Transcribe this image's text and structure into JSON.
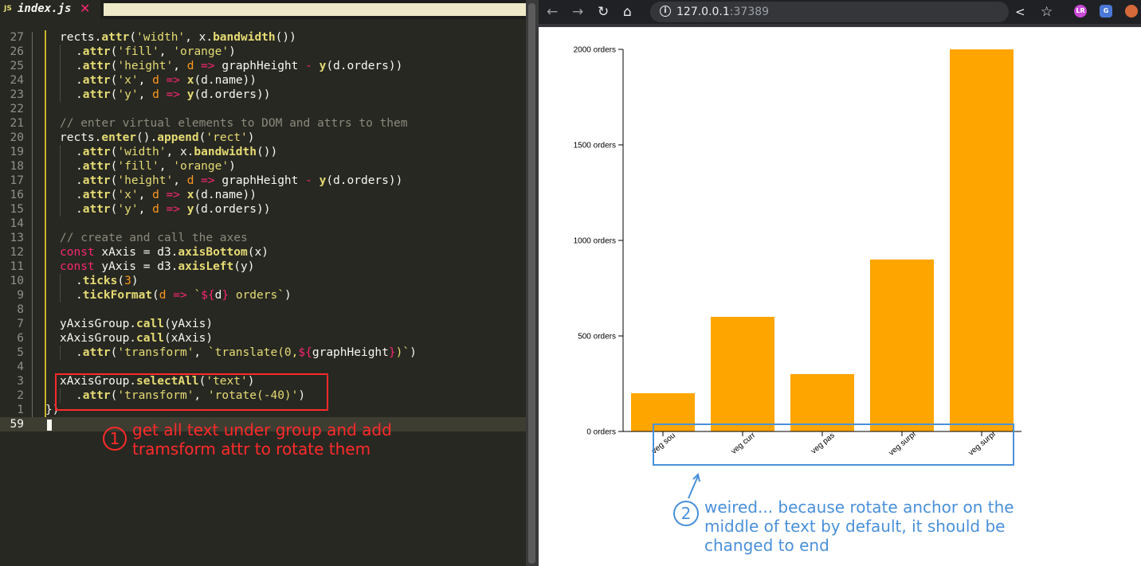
{
  "editor": {
    "tab": {
      "badge": "JS",
      "filename": "index.js",
      "close_glyph": "✕"
    },
    "lines": [
      {
        "num": "27",
        "segs": [
          [
            "v",
            "rects."
          ],
          [
            "f",
            "attr"
          ],
          [
            "v",
            "("
          ],
          [
            "s",
            "'width'"
          ],
          [
            "v",
            ", x."
          ],
          [
            "f",
            "bandwidth"
          ],
          [
            "v",
            "())"
          ]
        ],
        "indent": 0
      },
      {
        "num": "26",
        "segs": [
          [
            "v",
            "."
          ],
          [
            "f",
            "attr"
          ],
          [
            "v",
            "("
          ],
          [
            "s",
            "'fill'"
          ],
          [
            "v",
            ", "
          ],
          [
            "s",
            "'orange'"
          ],
          [
            "v",
            ")"
          ]
        ],
        "indent": 1
      },
      {
        "num": "25",
        "segs": [
          [
            "v",
            "."
          ],
          [
            "f",
            "attr"
          ],
          [
            "v",
            "("
          ],
          [
            "s",
            "'height'"
          ],
          [
            "v",
            ", "
          ],
          [
            "a",
            "d"
          ],
          [
            "o",
            " => "
          ],
          [
            "v",
            "graphHeight "
          ],
          [
            "o",
            "-"
          ],
          [
            "v",
            " "
          ],
          [
            "f",
            "y"
          ],
          [
            "v",
            "(d.orders))"
          ]
        ],
        "indent": 1
      },
      {
        "num": "24",
        "segs": [
          [
            "v",
            "."
          ],
          [
            "f",
            "attr"
          ],
          [
            "v",
            "("
          ],
          [
            "s",
            "'x'"
          ],
          [
            "v",
            ", "
          ],
          [
            "a",
            "d"
          ],
          [
            "o",
            " => "
          ],
          [
            "f",
            "x"
          ],
          [
            "v",
            "(d.name))"
          ]
        ],
        "indent": 1
      },
      {
        "num": "23",
        "segs": [
          [
            "v",
            "."
          ],
          [
            "f",
            "attr"
          ],
          [
            "v",
            "("
          ],
          [
            "s",
            "'y'"
          ],
          [
            "v",
            ", "
          ],
          [
            "a",
            "d"
          ],
          [
            "o",
            " => "
          ],
          [
            "f",
            "y"
          ],
          [
            "v",
            "(d.orders))"
          ]
        ],
        "indent": 1
      },
      {
        "num": "22",
        "segs": [],
        "indent": 0
      },
      {
        "num": "21",
        "segs": [
          [
            "c",
            "// enter virtual elements to DOM and attrs to them"
          ]
        ],
        "indent": 0
      },
      {
        "num": "20",
        "segs": [
          [
            "v",
            "rects."
          ],
          [
            "f",
            "enter"
          ],
          [
            "v",
            "()."
          ],
          [
            "f",
            "append"
          ],
          [
            "v",
            "("
          ],
          [
            "s",
            "'rect'"
          ],
          [
            "v",
            ")"
          ]
        ],
        "indent": 0
      },
      {
        "num": "19",
        "segs": [
          [
            "v",
            "."
          ],
          [
            "f",
            "attr"
          ],
          [
            "v",
            "("
          ],
          [
            "s",
            "'width'"
          ],
          [
            "v",
            ", x."
          ],
          [
            "f",
            "bandwidth"
          ],
          [
            "v",
            "())"
          ]
        ],
        "indent": 1
      },
      {
        "num": "18",
        "segs": [
          [
            "v",
            "."
          ],
          [
            "f",
            "attr"
          ],
          [
            "v",
            "("
          ],
          [
            "s",
            "'fill'"
          ],
          [
            "v",
            ", "
          ],
          [
            "s",
            "'orange'"
          ],
          [
            "v",
            ")"
          ]
        ],
        "indent": 1
      },
      {
        "num": "17",
        "segs": [
          [
            "v",
            "."
          ],
          [
            "f",
            "attr"
          ],
          [
            "v",
            "("
          ],
          [
            "s",
            "'height'"
          ],
          [
            "v",
            ", "
          ],
          [
            "a",
            "d"
          ],
          [
            "o",
            " => "
          ],
          [
            "v",
            "graphHeight "
          ],
          [
            "o",
            "-"
          ],
          [
            "v",
            " "
          ],
          [
            "f",
            "y"
          ],
          [
            "v",
            "(d.orders))"
          ]
        ],
        "indent": 1
      },
      {
        "num": "16",
        "segs": [
          [
            "v",
            "."
          ],
          [
            "f",
            "attr"
          ],
          [
            "v",
            "("
          ],
          [
            "s",
            "'x'"
          ],
          [
            "v",
            ", "
          ],
          [
            "a",
            "d"
          ],
          [
            "o",
            " => "
          ],
          [
            "f",
            "x"
          ],
          [
            "v",
            "(d.name))"
          ]
        ],
        "indent": 1
      },
      {
        "num": "15",
        "segs": [
          [
            "v",
            "."
          ],
          [
            "f",
            "attr"
          ],
          [
            "v",
            "("
          ],
          [
            "s",
            "'y'"
          ],
          [
            "v",
            ", "
          ],
          [
            "a",
            "d"
          ],
          [
            "o",
            " => "
          ],
          [
            "f",
            "y"
          ],
          [
            "v",
            "(d.orders))"
          ]
        ],
        "indent": 1
      },
      {
        "num": "14",
        "segs": [],
        "indent": 0
      },
      {
        "num": "13",
        "segs": [
          [
            "c",
            "// create and call the axes"
          ]
        ],
        "indent": 0
      },
      {
        "num": "12",
        "segs": [
          [
            "k",
            "const"
          ],
          [
            "v",
            " xAxis = d3."
          ],
          [
            "f",
            "axisBottom"
          ],
          [
            "v",
            "(x)"
          ]
        ],
        "indent": 0
      },
      {
        "num": "11",
        "segs": [
          [
            "k",
            "const"
          ],
          [
            "v",
            " yAxis = d3."
          ],
          [
            "f",
            "axisLeft"
          ],
          [
            "v",
            "(y)"
          ]
        ],
        "indent": 0
      },
      {
        "num": "10",
        "segs": [
          [
            "v",
            "."
          ],
          [
            "f",
            "ticks"
          ],
          [
            "v",
            "("
          ],
          [
            "a",
            "3"
          ],
          [
            "v",
            ")"
          ]
        ],
        "indent": 1
      },
      {
        "num": "9",
        "segs": [
          [
            "v",
            "."
          ],
          [
            "f",
            "tickFormat"
          ],
          [
            "v",
            "("
          ],
          [
            "a",
            "d"
          ],
          [
            "o",
            " => "
          ],
          [
            "s",
            "`"
          ],
          [
            "k",
            "${"
          ],
          [
            "v",
            "d"
          ],
          [
            "k",
            "}"
          ],
          [
            "s",
            " orders`"
          ],
          [
            "v",
            ")"
          ]
        ],
        "indent": 1
      },
      {
        "num": "8",
        "segs": [],
        "indent": 0
      },
      {
        "num": "7",
        "segs": [
          [
            "v",
            "yAxisGroup."
          ],
          [
            "f",
            "call"
          ],
          [
            "v",
            "(yAxis)"
          ]
        ],
        "indent": 0
      },
      {
        "num": "6",
        "segs": [
          [
            "v",
            "xAxisGroup."
          ],
          [
            "f",
            "call"
          ],
          [
            "v",
            "(xAxis)"
          ]
        ],
        "indent": 0
      },
      {
        "num": "5",
        "segs": [
          [
            "v",
            "."
          ],
          [
            "f",
            "attr"
          ],
          [
            "v",
            "("
          ],
          [
            "s",
            "'transform'"
          ],
          [
            "v",
            ", "
          ],
          [
            "s",
            "`translate(0,"
          ],
          [
            "k",
            "${"
          ],
          [
            "v",
            "graphHeight"
          ],
          [
            "k",
            "}"
          ],
          [
            "s",
            ")`"
          ],
          [
            "v",
            ")"
          ]
        ],
        "indent": 1
      },
      {
        "num": "4",
        "segs": [],
        "indent": 0
      },
      {
        "num": "3",
        "segs": [
          [
            "v",
            "xAxisGroup."
          ],
          [
            "f",
            "selectAll"
          ],
          [
            "v",
            "("
          ],
          [
            "s",
            "'text'"
          ],
          [
            "v",
            ")"
          ]
        ],
        "indent": 0
      },
      {
        "num": "2",
        "segs": [
          [
            "v",
            "."
          ],
          [
            "f",
            "attr"
          ],
          [
            "v",
            "("
          ],
          [
            "s",
            "'transform'"
          ],
          [
            "v",
            ", "
          ],
          [
            "s",
            "'rotate(-40)'"
          ],
          [
            "v",
            ")"
          ]
        ],
        "indent": 1
      },
      {
        "num": "1",
        "segs": [
          [
            "v",
            "})"
          ]
        ],
        "indent": -1
      },
      {
        "num": "59",
        "segs": [],
        "indent": 0,
        "current": true
      }
    ],
    "annotation": {
      "number": "1",
      "text": "get all text under group and add tramsform attr to rotate them"
    }
  },
  "browser": {
    "url_host": "127.0.0.1",
    "url_port": ":37389",
    "icons": {
      "back": "back-icon",
      "forward": "forward-icon",
      "reload": "reload-icon",
      "home": "home-icon",
      "info": "info-icon",
      "share": "share-icon",
      "bookmark": "star-icon"
    },
    "extensions": [
      {
        "label": "LR",
        "color": "#c84ad6"
      },
      {
        "label": "G",
        "color": "#4a78d6"
      },
      {
        "label": "",
        "color": "#d6693a"
      }
    ],
    "annotation": {
      "number": "2",
      "text": "weired... because rotate anchor on the middle of text by default, it should be changed to end"
    }
  },
  "colors": {
    "bar": "#ffa500",
    "note_red": "#ff2a2a",
    "note_blue": "#4a90d9"
  },
  "chart_data": {
    "type": "bar",
    "categories": [
      "veg soup",
      "veg curry",
      "veg pasta",
      "veg surprise",
      "veg surprise"
    ],
    "tick_labels_shown": [
      "veg sou",
      "veg curr",
      "veg pas",
      "veg surpr",
      "veg surpr"
    ],
    "values": [
      200,
      600,
      300,
      900,
      2000
    ],
    "ylim": [
      0,
      2000
    ],
    "y_ticks": [
      0,
      500,
      1000,
      1500,
      2000
    ],
    "tick_format": "{d} orders",
    "x_tick_rotation_deg": -40,
    "bar_color": "#ffa500",
    "grid": false,
    "title": "",
    "xlabel": "",
    "ylabel": ""
  }
}
